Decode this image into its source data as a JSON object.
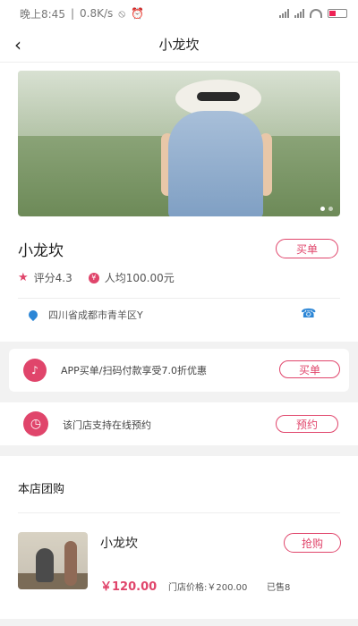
{
  "status_bar": {
    "time": "晚上8:45",
    "speed": "0.8K/s",
    "mute_icon": "mute-icon",
    "alarm_icon": "alarm-icon"
  },
  "header": {
    "title": "小龙坎",
    "back_icon": "back-icon"
  },
  "store": {
    "name": "小龙坎",
    "buy_button": "买单",
    "rating_label": "评分4.3",
    "avg_label": "人均100.00元",
    "address": "四川省成都市青羊区Y"
  },
  "promos": [
    {
      "icon": "double-bell-icon",
      "text": "APP买单/扫码付款享受7.0折优惠",
      "button": "买单"
    },
    {
      "icon": "clock-icon",
      "text": "该门店支持在线预约",
      "button": "预约"
    }
  ],
  "group_buy": {
    "section_title": "本店团购",
    "item": {
      "title": "小龙坎",
      "price": "￥120.00",
      "store_price": "门店价格:￥200.00",
      "sold": "已售8",
      "button": "抢购"
    }
  },
  "colors": {
    "accent": "#e0456b",
    "link_blue": "#2c86d6"
  }
}
